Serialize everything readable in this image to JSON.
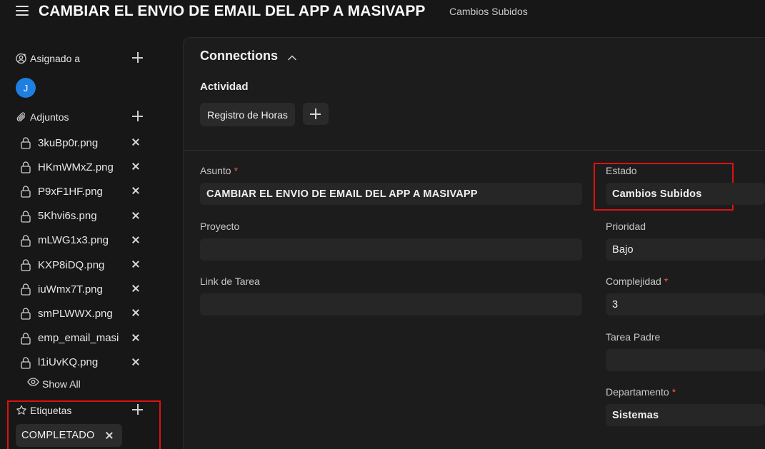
{
  "header": {
    "title": "CAMBIAR EL ENVIO DE EMAIL DEL APP A MASIVAPP",
    "status": "Cambios Subidos"
  },
  "sidebar": {
    "assigned": {
      "label": "Asignado a",
      "avatar_initial": "J",
      "avatar_color": "#1e7fe0"
    },
    "attachments": {
      "label": "Adjuntos",
      "files": [
        "3kuBp0r.png",
        "HKmWMxZ.png",
        "P9xF1HF.png",
        "5Khvi6s.png",
        "mLWG1x3.png",
        "KXP8iDQ.png",
        "iuWmx7T.png",
        "smPLWWX.png",
        "emp_email_masi",
        "l1iUvKQ.png"
      ],
      "show_all": "Show All"
    },
    "tags": {
      "label": "Etiquetas",
      "items": [
        "COMPLETADO"
      ]
    }
  },
  "connections": {
    "title": "Connections",
    "activity_label": "Actividad",
    "activity_button": "Registro de Horas"
  },
  "form": {
    "asunto": {
      "label": "Asunto",
      "value": "CAMBIAR EL ENVIO DE EMAIL DEL APP A MASIVAPP",
      "required": "*"
    },
    "proyecto": {
      "label": "Proyecto",
      "value": ""
    },
    "link_tarea": {
      "label": "Link de Tarea",
      "value": ""
    },
    "estado": {
      "label": "Estado",
      "value": "Cambios Subidos"
    },
    "prioridad": {
      "label": "Prioridad",
      "value": "Bajo"
    },
    "complejidad": {
      "label": "Complejidad",
      "value": "3",
      "required": "*"
    },
    "tarea_padre": {
      "label": "Tarea Padre",
      "value": ""
    },
    "departamento": {
      "label": "Departamento",
      "value": "Sistemas",
      "required": "*"
    }
  },
  "colors": {
    "highlight": "#e01010",
    "required": "#ef5a4c"
  }
}
